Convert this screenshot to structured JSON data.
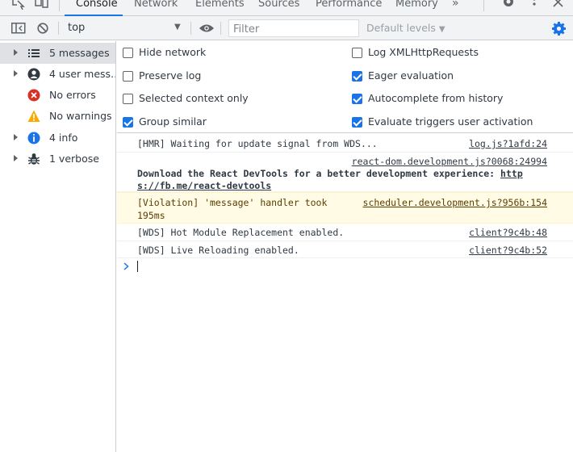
{
  "tabs": [
    {
      "label": "Console",
      "active": true
    },
    {
      "label": "Network"
    },
    {
      "label": "Elements"
    },
    {
      "label": "Sources"
    },
    {
      "label": "Performance"
    },
    {
      "label": "Memory"
    }
  ],
  "toolbar": {
    "context": "top",
    "filter_placeholder": "Filter",
    "levels": "Default levels"
  },
  "sidebar": {
    "items": [
      {
        "label": "5 messages",
        "icon": "list-icon"
      },
      {
        "label": "4 user mess…",
        "icon": "user-icon"
      },
      {
        "label": "No errors",
        "icon": "error-icon"
      },
      {
        "label": "No warnings",
        "icon": "warning-icon"
      },
      {
        "label": "4 info",
        "icon": "info-icon"
      },
      {
        "label": "1 verbose",
        "icon": "bug-icon"
      }
    ]
  },
  "settings": [
    {
      "label": "Hide network",
      "checked": false
    },
    {
      "label": "Preserve log",
      "checked": false
    },
    {
      "label": "Selected context only",
      "checked": false
    },
    {
      "label": "Group similar",
      "checked": true
    },
    {
      "label": "Log XMLHttpRequests",
      "checked": false
    },
    {
      "label": "Eager evaluation",
      "checked": true
    },
    {
      "label": "Autocomplete from history",
      "checked": true
    },
    {
      "label": "Evaluate triggers user activation",
      "checked": true
    }
  ],
  "messages": [
    {
      "text": "[HMR] Waiting for update signal from WDS...",
      "source": "log.js?1afd:24"
    },
    {
      "source": "react-dom.development.js?0068:24994",
      "text_bold": "Download the React DevTools for a better development experience: ",
      "link_part1": "http",
      "link_part2": "s://fb.me/react-devtools"
    },
    {
      "text": "[Violation] 'message' handler took",
      "text2": "195ms",
      "source": "scheduler.development.js?956b:154",
      "level": "warning"
    },
    {
      "text": "[WDS] Hot Module Replacement enabled.",
      "source": "client?9c4b:48"
    },
    {
      "text": "[WDS] Live Reloading enabled.",
      "source": "client?9c4b:52"
    }
  ],
  "colors": {
    "accent": "#1a73e8",
    "error": "#d93025",
    "warning": "#f9ab00",
    "violation_bg": "#fffbe5"
  }
}
